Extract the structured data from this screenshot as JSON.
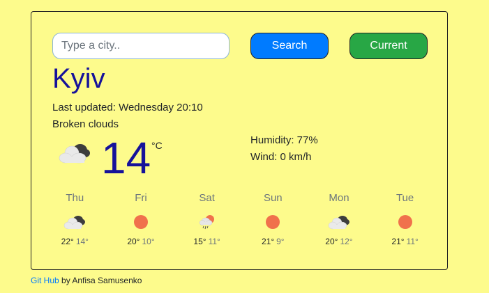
{
  "search": {
    "placeholder": "Type a city..",
    "value": "",
    "search_label": "Search",
    "current_label": "Current"
  },
  "weather": {
    "city": "Kyiv",
    "last_updated": "Last updated: Wednesday 20:10",
    "description": "Broken clouds",
    "temperature": "14",
    "unit": "°C",
    "humidity": "Humidity: 77%",
    "wind": "Wind: 0 km/h",
    "icon": "broken-clouds-icon"
  },
  "forecast": [
    {
      "day": "Thu",
      "icon": "broken-clouds-icon",
      "max": "22°",
      "min": "14°"
    },
    {
      "day": "Fri",
      "icon": "sun-icon",
      "max": "20°",
      "min": "10°"
    },
    {
      "day": "Sat",
      "icon": "rain-icon",
      "max": "15°",
      "min": "11°"
    },
    {
      "day": "Sun",
      "icon": "sun-icon",
      "max": "21°",
      "min": "9°"
    },
    {
      "day": "Mon",
      "icon": "broken-clouds-icon",
      "max": "20°",
      "min": "12°"
    },
    {
      "day": "Tue",
      "icon": "sun-icon",
      "max": "21°",
      "min": "11°"
    }
  ],
  "footer": {
    "link_label": "Git Hub",
    "author": " by Anfisa Samusenko"
  },
  "colors": {
    "background": "#fdfb8c",
    "accent_text": "#16129a",
    "search_button": "#007bff",
    "current_button": "#28a745",
    "sun": "#f0714c"
  }
}
